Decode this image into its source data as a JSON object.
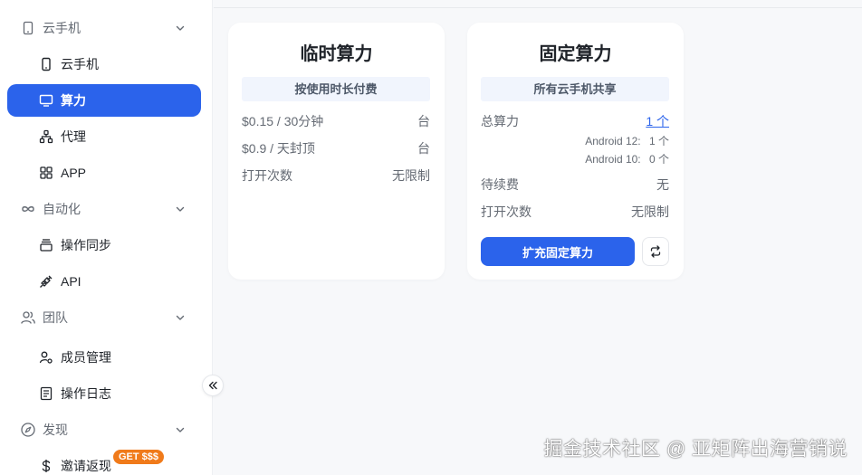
{
  "sidebar": {
    "groups": [
      {
        "label": "云手机",
        "icon": "phone-outline-icon",
        "expanded": true
      },
      {
        "label": "自动化",
        "icon": "infinity-icon",
        "expanded": true
      },
      {
        "label": "团队",
        "icon": "users-icon",
        "expanded": true
      },
      {
        "label": "发现",
        "icon": "compass-icon",
        "expanded": true
      }
    ],
    "items": [
      {
        "label": "云手机",
        "icon": "smartphone-icon",
        "active": false
      },
      {
        "label": "算力",
        "icon": "monitor-icon",
        "active": true
      },
      {
        "label": "代理",
        "icon": "network-icon",
        "active": false
      },
      {
        "label": "APP",
        "icon": "apps-grid-icon",
        "active": false
      },
      {
        "label": "操作同步",
        "icon": "layers-icon",
        "active": false
      },
      {
        "label": "API",
        "icon": "plug-icon",
        "active": false
      },
      {
        "label": "成员管理",
        "icon": "member-settings-icon",
        "active": false
      },
      {
        "label": "操作日志",
        "icon": "log-document-icon",
        "active": false
      },
      {
        "label": "邀请返现",
        "icon": "dollar-icon",
        "active": false
      }
    ],
    "invite_badge": "GET $$$",
    "collapse_icon": "double-chevron-left-icon"
  },
  "cards": {
    "temporary": {
      "title": "临时算力",
      "pill": "按使用时长付费",
      "rows": [
        {
          "left": "$0.15 / 30分钟",
          "right": "台"
        },
        {
          "left": "$0.9 / 天封顶",
          "right": "台"
        },
        {
          "left": "打开次数",
          "right": "无限制"
        }
      ]
    },
    "fixed": {
      "title": "固定算力",
      "pill": "所有云手机共享",
      "total_label": "总算力",
      "total_value": "1 个",
      "breakdown": [
        {
          "label": "Android 12:",
          "value": "1 个"
        },
        {
          "label": "Android 10:",
          "value": "0 个"
        }
      ],
      "renewal_label": "待续费",
      "renewal_value": "无",
      "opens_label": "打开次数",
      "opens_value": "无限制",
      "expand_button": "扩充固定算力",
      "refresh_icon": "refresh-icon"
    }
  },
  "watermark": "掘金技术社区 @ 亚矩阵出海营销说",
  "colors": {
    "accent": "#2b63eb",
    "badge": "#f07a1a",
    "pill_bg": "#f1f5fd",
    "page_bg": "#f7f8fa"
  }
}
